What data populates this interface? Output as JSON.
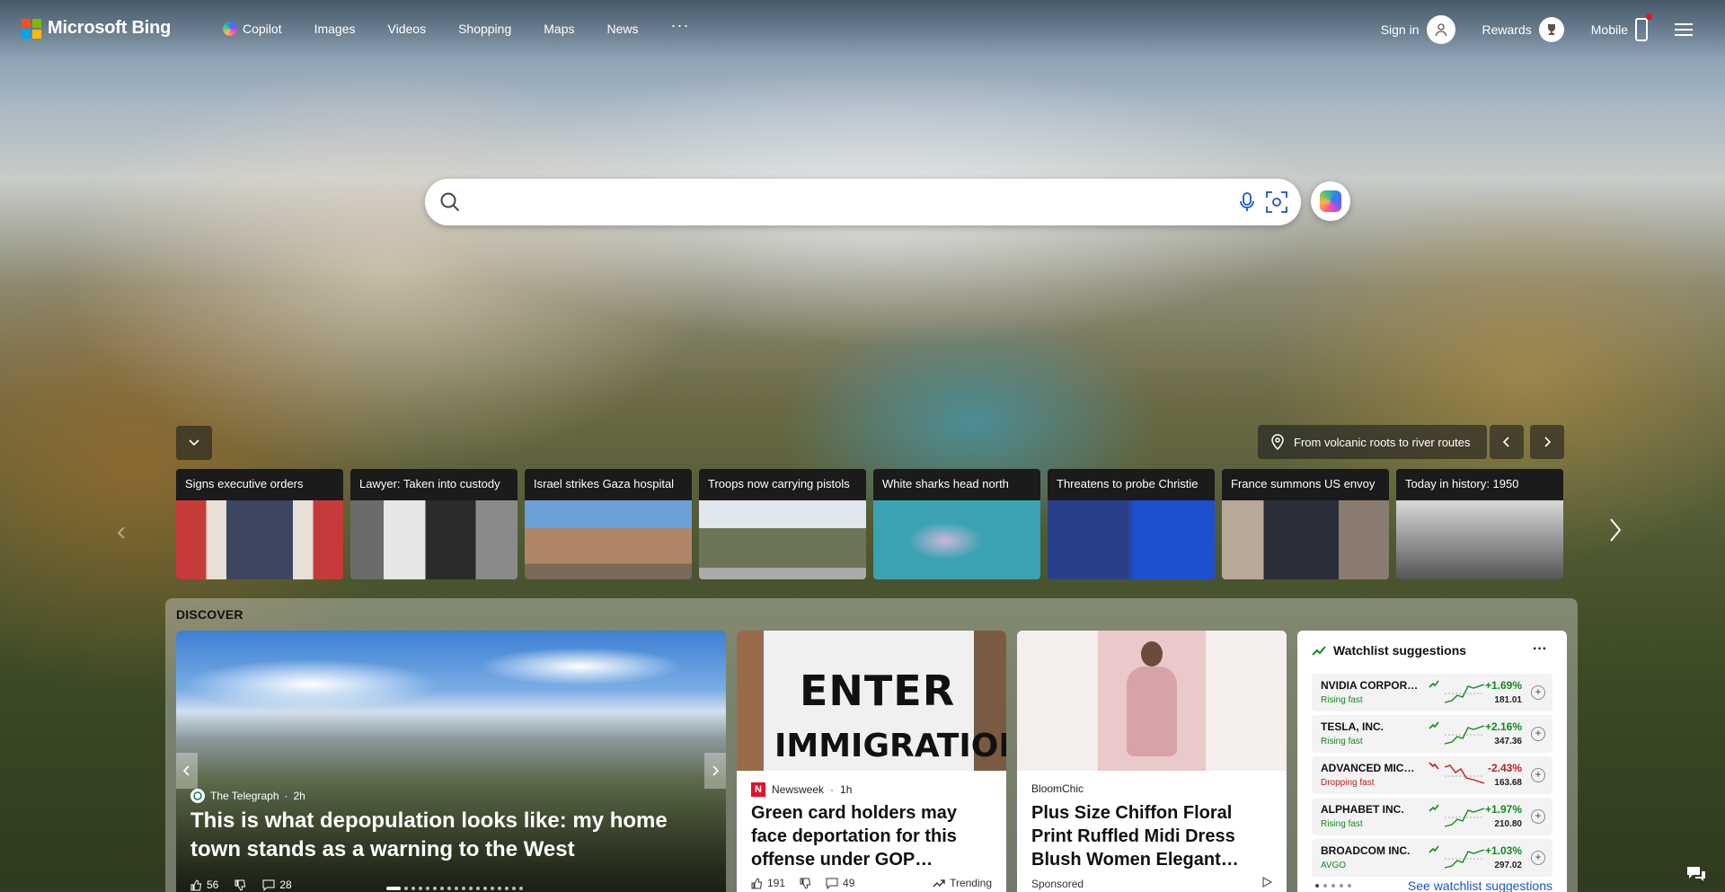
{
  "brand": {
    "name": "Microsoft Bing"
  },
  "nav": {
    "items": [
      "Copilot",
      "Images",
      "Videos",
      "Shopping",
      "Maps",
      "News"
    ],
    "more": "···"
  },
  "header": {
    "sign_in": "Sign in",
    "rewards": "Rewards",
    "mobile": "Mobile"
  },
  "search": {
    "value": "",
    "placeholder": ""
  },
  "location": {
    "label": "From volcanic roots to river routes"
  },
  "carousel": [
    {
      "title": "Signs executive orders"
    },
    {
      "title": "Lawyer: Taken into custody"
    },
    {
      "title": "Israel strikes Gaza hospital"
    },
    {
      "title": "Troops now carrying pistols"
    },
    {
      "title": "White sharks head north"
    },
    {
      "title": "Threatens to probe Christie"
    },
    {
      "title": "France summons US envoy"
    },
    {
      "title": "Today in history: 1950"
    }
  ],
  "discover": {
    "label": "DISCOVER",
    "hero": {
      "source": "The Telegraph",
      "age": "2h",
      "title": "This is what depopulation looks like: my home town stands as a warning to the West",
      "likes": "56",
      "comments": "28"
    },
    "card1": {
      "source": "Newsweek",
      "age": "1h",
      "title": "Green card holders may face deportation for this offense under GOP…",
      "likes": "191",
      "comments": "49",
      "trending": "Trending",
      "sign_top": "ENTER",
      "sign_bottom": "IMMIGRATION"
    },
    "card2": {
      "source": "BloomChic",
      "title": "Plus Size Chiffon Floral Print Ruffled Midi Dress Blush Women Elegant…",
      "sponsored": "Sponsored"
    },
    "watchlist": {
      "title": "Watchlist suggestions",
      "more": "···",
      "see_more": "See watchlist suggestions",
      "rows": [
        {
          "name": "NVIDIA CORPOR…",
          "status": "Rising fast",
          "change": "+1.69%",
          "price": "181.01",
          "direction": "up"
        },
        {
          "name": "TESLA, INC.",
          "status": "Rising fast",
          "change": "+2.16%",
          "price": "347.36",
          "direction": "up"
        },
        {
          "name": "ADVANCED MIC…",
          "status": "Dropping fast",
          "change": "-2.43%",
          "price": "163.68",
          "direction": "down"
        },
        {
          "name": "ALPHABET INC.",
          "status": "Rising fast",
          "change": "+1.97%",
          "price": "210.80",
          "direction": "up"
        },
        {
          "name": "BROADCOM INC.",
          "status": "AVGO",
          "change": "+1.03%",
          "price": "297.02",
          "direction": "up"
        }
      ]
    }
  },
  "colors": {
    "up": "#128a1e",
    "down": "#c41b1b",
    "link": "#1a55c4",
    "ms_red": "#f25022",
    "ms_green": "#7fba00",
    "ms_blue": "#00a4ef",
    "ms_yellow": "#ffb900"
  }
}
